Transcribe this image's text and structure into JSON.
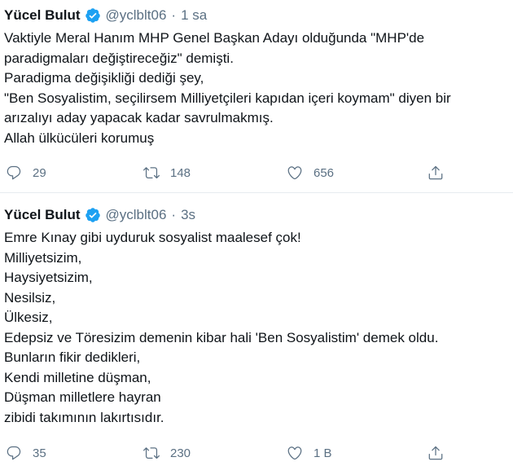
{
  "tweets": [
    {
      "author_name": "Yücel Bulut",
      "handle": "@yclblt06",
      "separator": "·",
      "time": "1 sa",
      "lines": [
        "Vaktiyle Meral Hanım MHP Genel Başkan Adayı olduğunda \"MHP'de",
        "paradigmaları değiştireceğiz\" demişti.",
        "Paradigma değişikliği dediği şey,",
        "\"Ben Sosyalistim, seçilirsem Milliyetçileri kapıdan içeri koymam\" diyen bir",
        "arızalıyı aday yapacak kadar savrulmakmış.",
        "Allah ülkücüleri korumuş"
      ],
      "actions": {
        "reply_count": "29",
        "retweet_count": "148",
        "like_count": "656"
      }
    },
    {
      "author_name": "Yücel Bulut",
      "handle": "@yclblt06",
      "separator": "·",
      "time": "3s",
      "lines": [
        "Emre Kınay gibi uyduruk sosyalist maalesef çok!",
        "Milliyetsizim,",
        "Haysiyetsizim,",
        "Nesilsiz,",
        "Ülkesiz,",
        "Edepsiz ve Töresizim demenin kibar hali 'Ben Sosyalistim' demek oldu.",
        "Bunların fikir dedikleri,",
        "Kendi milletine düşman,",
        "Düşman milletlere hayran",
        "zibidi takımının lakırtısıdır."
      ],
      "actions": {
        "reply_count": "35",
        "retweet_count": "230",
        "like_count": "1 B"
      }
    }
  ],
  "icons": {
    "verified": "verified-badge-icon",
    "reply": "reply-icon",
    "retweet": "retweet-icon",
    "like": "like-icon",
    "share": "share-icon"
  },
  "colors": {
    "text": "#0f1419",
    "secondary": "#5b7083",
    "verified_blue": "#1da1f2",
    "divider": "#e6ecf0"
  }
}
